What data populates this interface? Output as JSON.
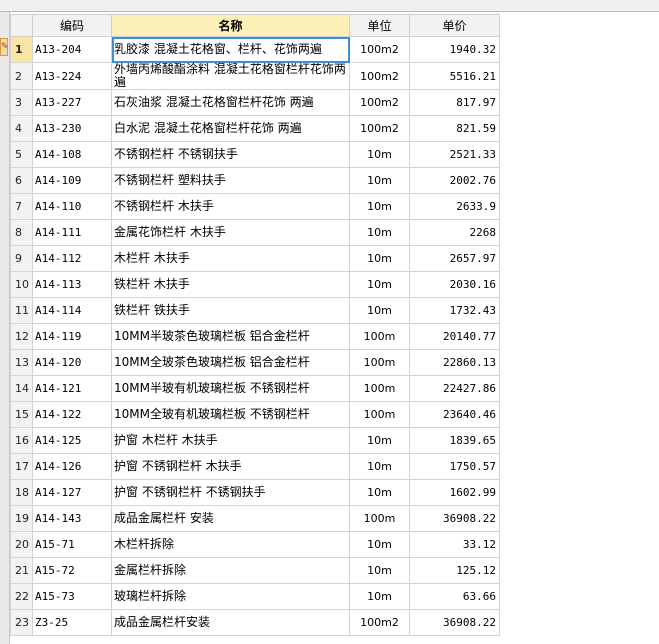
{
  "toolbar": {
    "icon": "edit-icon",
    "icon_glyph": "✎"
  },
  "columns": {
    "code": "编码",
    "name": "名称",
    "unit": "单位",
    "price": "单价"
  },
  "rows": [
    {
      "n": "1",
      "code": "A13-204",
      "name": "乳胶漆 混凝土花格窗、栏杆、花饰两遍",
      "unit": "100m2",
      "price": "1940.32"
    },
    {
      "n": "2",
      "code": "A13-224",
      "name": "外墙丙烯酸酯涂料 混凝土花格窗栏杆花饰两遍",
      "unit": "100m2",
      "price": "5516.21"
    },
    {
      "n": "3",
      "code": "A13-227",
      "name": "石灰油浆 混凝土花格窗栏杆花饰 两遍",
      "unit": "100m2",
      "price": "817.97"
    },
    {
      "n": "4",
      "code": "A13-230",
      "name": "白水泥 混凝土花格窗栏杆花饰 两遍",
      "unit": "100m2",
      "price": "821.59"
    },
    {
      "n": "5",
      "code": "A14-108",
      "name": "不锈钢栏杆 不锈钢扶手",
      "unit": "10m",
      "price": "2521.33"
    },
    {
      "n": "6",
      "code": "A14-109",
      "name": "不锈钢栏杆 塑料扶手",
      "unit": "10m",
      "price": "2002.76"
    },
    {
      "n": "7",
      "code": "A14-110",
      "name": "不锈钢栏杆 木扶手",
      "unit": "10m",
      "price": "2633.9"
    },
    {
      "n": "8",
      "code": "A14-111",
      "name": "金属花饰栏杆 木扶手",
      "unit": "10m",
      "price": "2268"
    },
    {
      "n": "9",
      "code": "A14-112",
      "name": "木栏杆 木扶手",
      "unit": "10m",
      "price": "2657.97"
    },
    {
      "n": "10",
      "code": "A14-113",
      "name": "铁栏杆 木扶手",
      "unit": "10m",
      "price": "2030.16"
    },
    {
      "n": "11",
      "code": "A14-114",
      "name": "铁栏杆 铁扶手",
      "unit": "10m",
      "price": "1732.43"
    },
    {
      "n": "12",
      "code": "A14-119",
      "name": "10MM半玻茶色玻璃栏板 铝合金栏杆",
      "unit": "100m",
      "price": "20140.77"
    },
    {
      "n": "13",
      "code": "A14-120",
      "name": "10MM全玻茶色玻璃栏板 铝合金栏杆",
      "unit": "100m",
      "price": "22860.13"
    },
    {
      "n": "14",
      "code": "A14-121",
      "name": "10MM半玻有机玻璃栏板 不锈钢栏杆",
      "unit": "100m",
      "price": "22427.86"
    },
    {
      "n": "15",
      "code": "A14-122",
      "name": "10MM全玻有机玻璃栏板 不锈钢栏杆",
      "unit": "100m",
      "price": "23640.46"
    },
    {
      "n": "16",
      "code": "A14-125",
      "name": "护窗 木栏杆 木扶手",
      "unit": "10m",
      "price": "1839.65"
    },
    {
      "n": "17",
      "code": "A14-126",
      "name": "护窗 不锈钢栏杆 木扶手",
      "unit": "10m",
      "price": "1750.57"
    },
    {
      "n": "18",
      "code": "A14-127",
      "name": "护窗 不锈钢栏杆 不锈钢扶手",
      "unit": "10m",
      "price": "1602.99"
    },
    {
      "n": "19",
      "code": "A14-143",
      "name": "成品金属栏杆 安装",
      "unit": "100m",
      "price": "36908.22"
    },
    {
      "n": "20",
      "code": "A15-71",
      "name": "木栏杆拆除",
      "unit": "10m",
      "price": "33.12"
    },
    {
      "n": "21",
      "code": "A15-72",
      "name": "金属栏杆拆除",
      "unit": "10m",
      "price": "125.12"
    },
    {
      "n": "22",
      "code": "A15-73",
      "name": "玻璃栏杆拆除",
      "unit": "10m",
      "price": "63.66"
    },
    {
      "n": "23",
      "code": "Z3-25",
      "name": "成品金属栏杆安装",
      "unit": "100m2",
      "price": "36908.22"
    }
  ]
}
